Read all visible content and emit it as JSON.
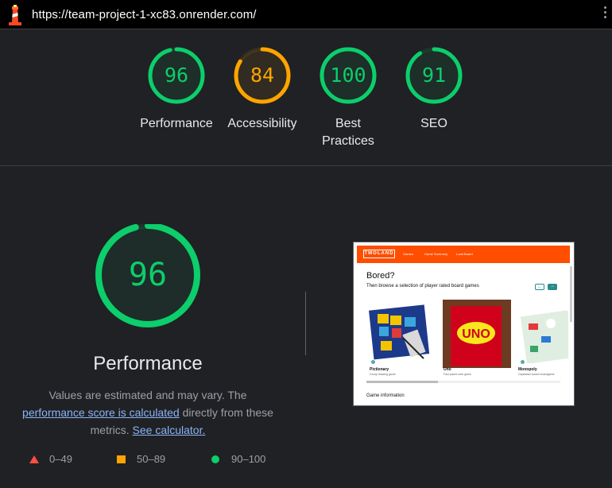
{
  "browser": {
    "url": "https://team-project-1-xc83.onrender.com/"
  },
  "categories": [
    {
      "label": "Performance",
      "score": "96",
      "value": 96,
      "color": "#0cce6b"
    },
    {
      "label": "Accessibility",
      "score": "84",
      "value": 84,
      "color": "#ffa400"
    },
    {
      "label": "Best\nPractices",
      "label_line1": "Best",
      "label_line2": "Practices",
      "score": "100",
      "value": 100,
      "color": "#0cce6b"
    },
    {
      "label": "SEO",
      "score": "91",
      "value": 91,
      "color": "#0cce6b"
    }
  ],
  "detail": {
    "score": "96",
    "value": 96,
    "title": "Performance",
    "desc_part1": "Values are estimated and may vary. The ",
    "desc_link1": "performance score is calculated",
    "desc_part2": " directly from these metrics. ",
    "desc_link2": "See calculator.",
    "color": "#0cce6b"
  },
  "legend": [
    {
      "range": "0–49",
      "shape": "triangle",
      "color": "#ff4e42"
    },
    {
      "range": "50–89",
      "shape": "square",
      "color": "#ffa400"
    },
    {
      "range": "90–100",
      "shape": "circle",
      "color": "#0cce6b"
    }
  ],
  "screenshot": {
    "logo": "TMOLAND",
    "nav": [
      "Games",
      "Game Summary",
      "Load Board"
    ],
    "heading": "Bored?",
    "subheading": "Then browse a selection of player rated board games",
    "prev": "←",
    "next": "→",
    "cards": [
      {
        "title": "Pictionary",
        "sub": "Group drawing game"
      },
      {
        "title": "Uno",
        "sub": "Fast paced card game"
      },
      {
        "title": "Monopoly",
        "sub": "Capitalism based boardgame"
      }
    ],
    "card_image_text": "UNO",
    "section": "Game information"
  }
}
